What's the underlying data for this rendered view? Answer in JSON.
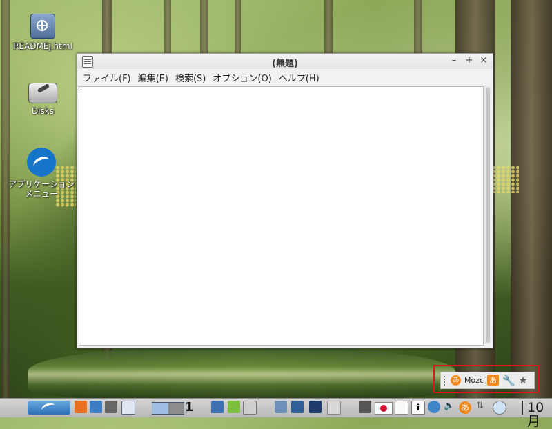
{
  "desktop": {
    "icons": [
      {
        "label": "READMEj.html",
        "icon": "globe-icon"
      },
      {
        "label": "Disks",
        "icon": "disk-utility-icon"
      },
      {
        "label": "アプリケーションメニュー",
        "icon": "lubuntu-bird-icon"
      }
    ]
  },
  "window": {
    "title": "(無題)",
    "controls": {
      "minimize": "–",
      "maximize": "+",
      "close": "×"
    },
    "menus": [
      "ファイル(F)",
      "編集(E)",
      "検索(S)",
      "オプション(O)",
      "ヘルプ(H)"
    ],
    "editor_text": ""
  },
  "ime_toolbar": {
    "mode_glyph": "あ",
    "name": "Mozc",
    "input_mode_glyph": "あ",
    "tool_icon": "wrench-icon",
    "fav_icon": "star-icon",
    "highlight_color": "#e0161b"
  },
  "taskbar": {
    "workspace_number": "1",
    "clock_text": "10月",
    "tray_ime_glyph": "あ",
    "info_glyph": "i"
  },
  "colors": {
    "accent_orange": "#f08a1c",
    "window_bg": "#f2f2f2"
  }
}
